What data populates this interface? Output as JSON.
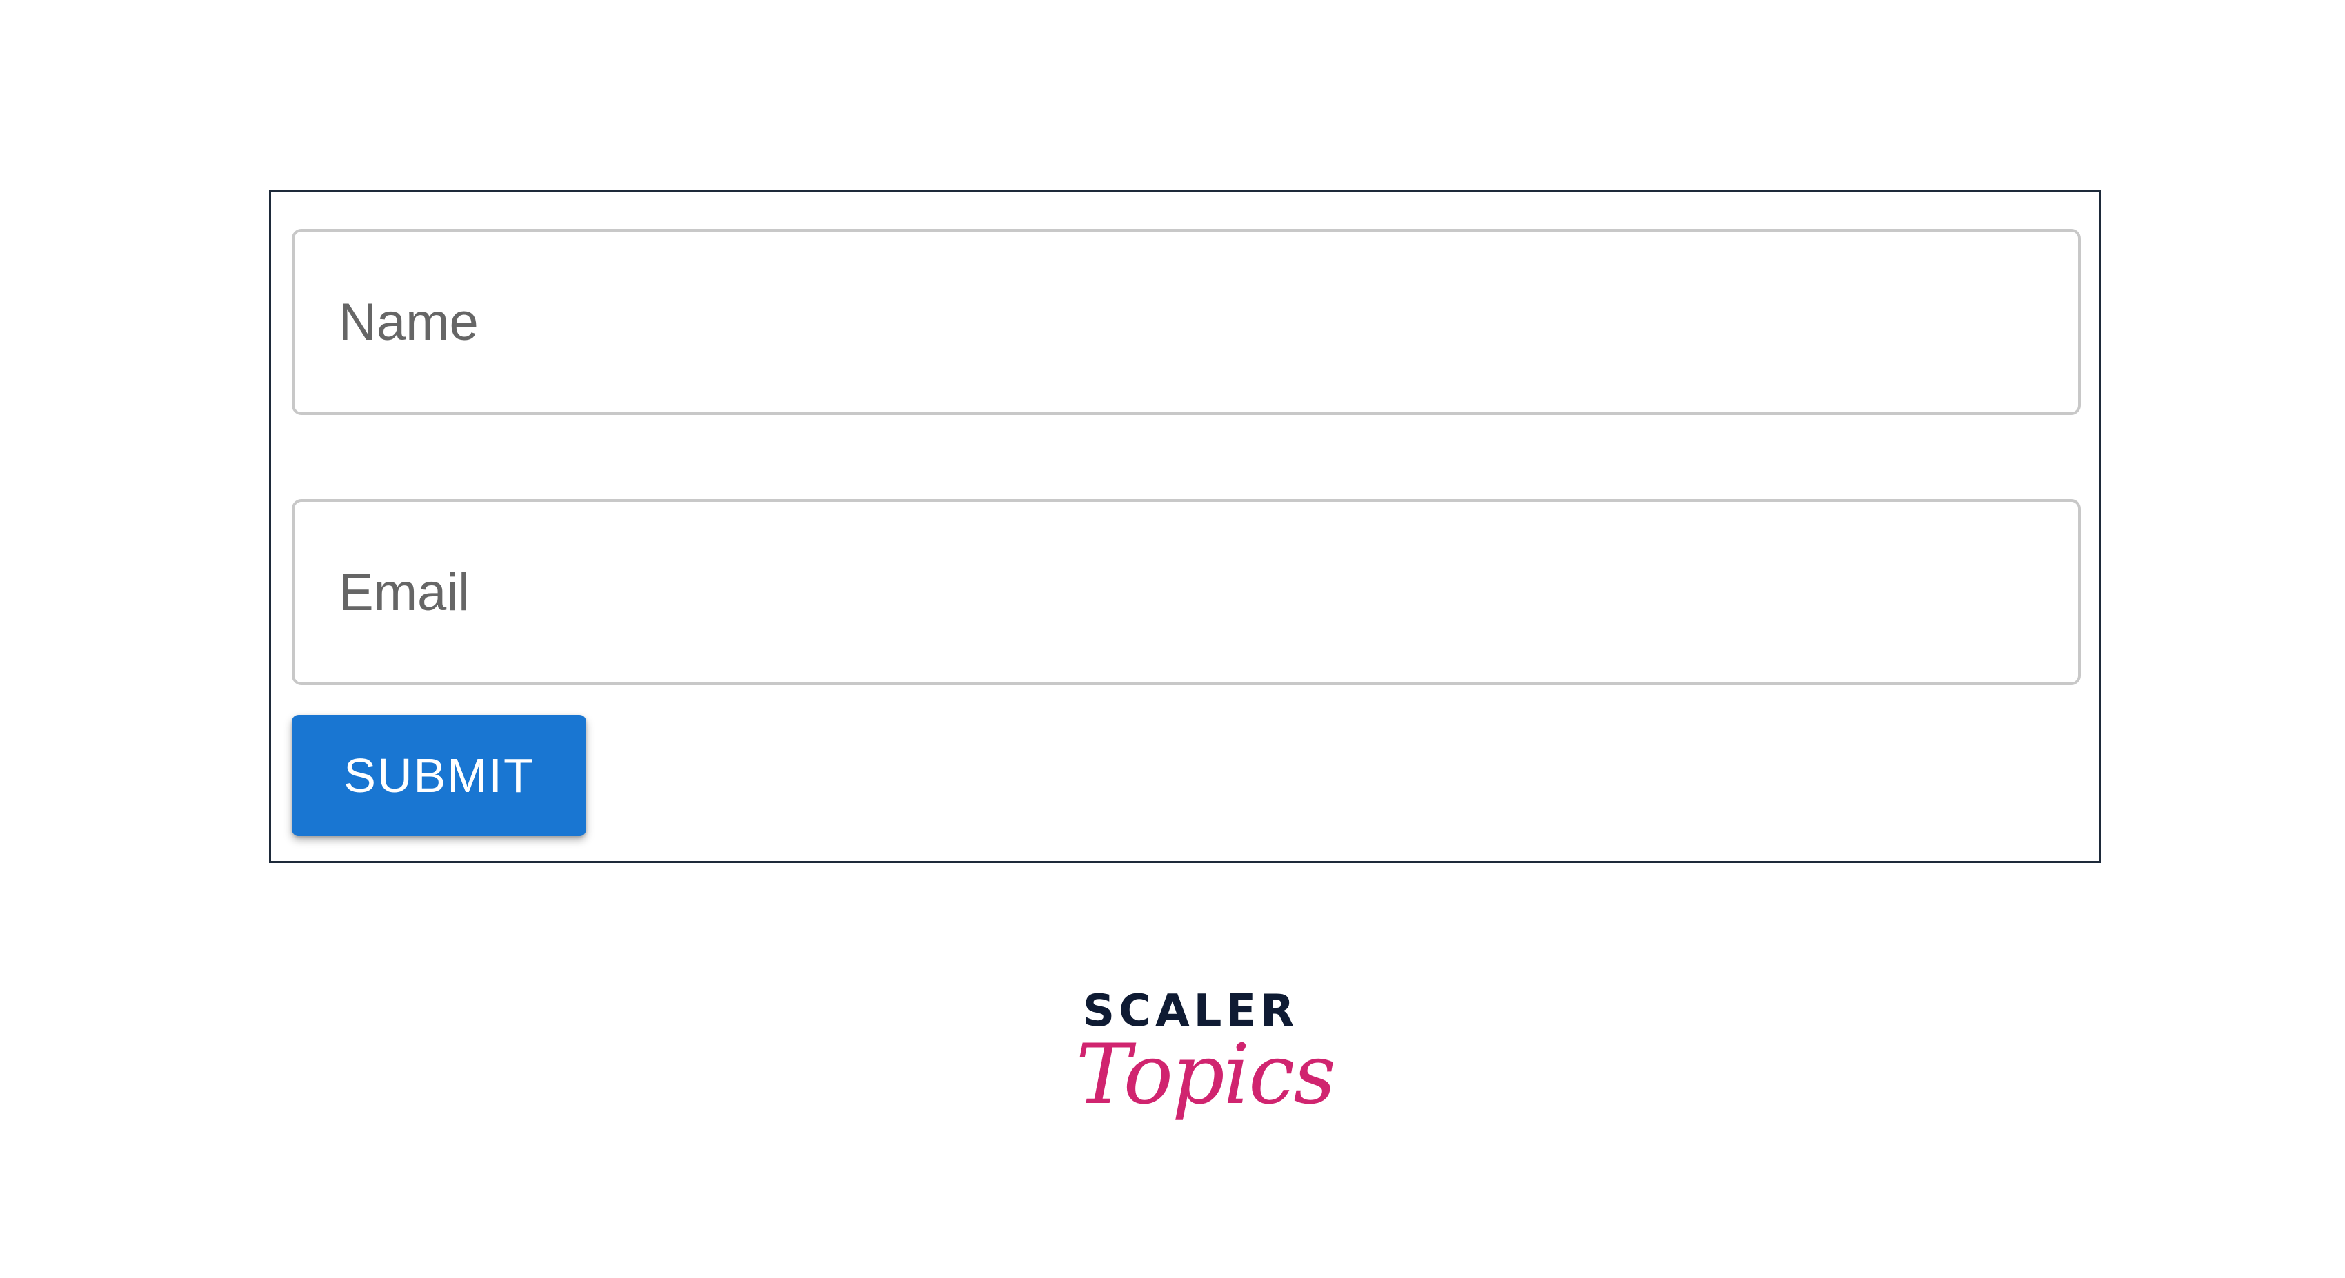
{
  "form": {
    "name_field": {
      "placeholder": "Name",
      "value": ""
    },
    "email_field": {
      "placeholder": "Email",
      "value": ""
    },
    "submit_label": "SUBMIT"
  },
  "brand": {
    "top_word": "SCALER",
    "script_word": "Topics"
  },
  "colors": {
    "button": "#1976d2",
    "frame_border": "#1e2a3a",
    "field_border": "#c8c8c8",
    "brand_dark": "#0f1b33",
    "brand_accent": "#d0246f"
  }
}
